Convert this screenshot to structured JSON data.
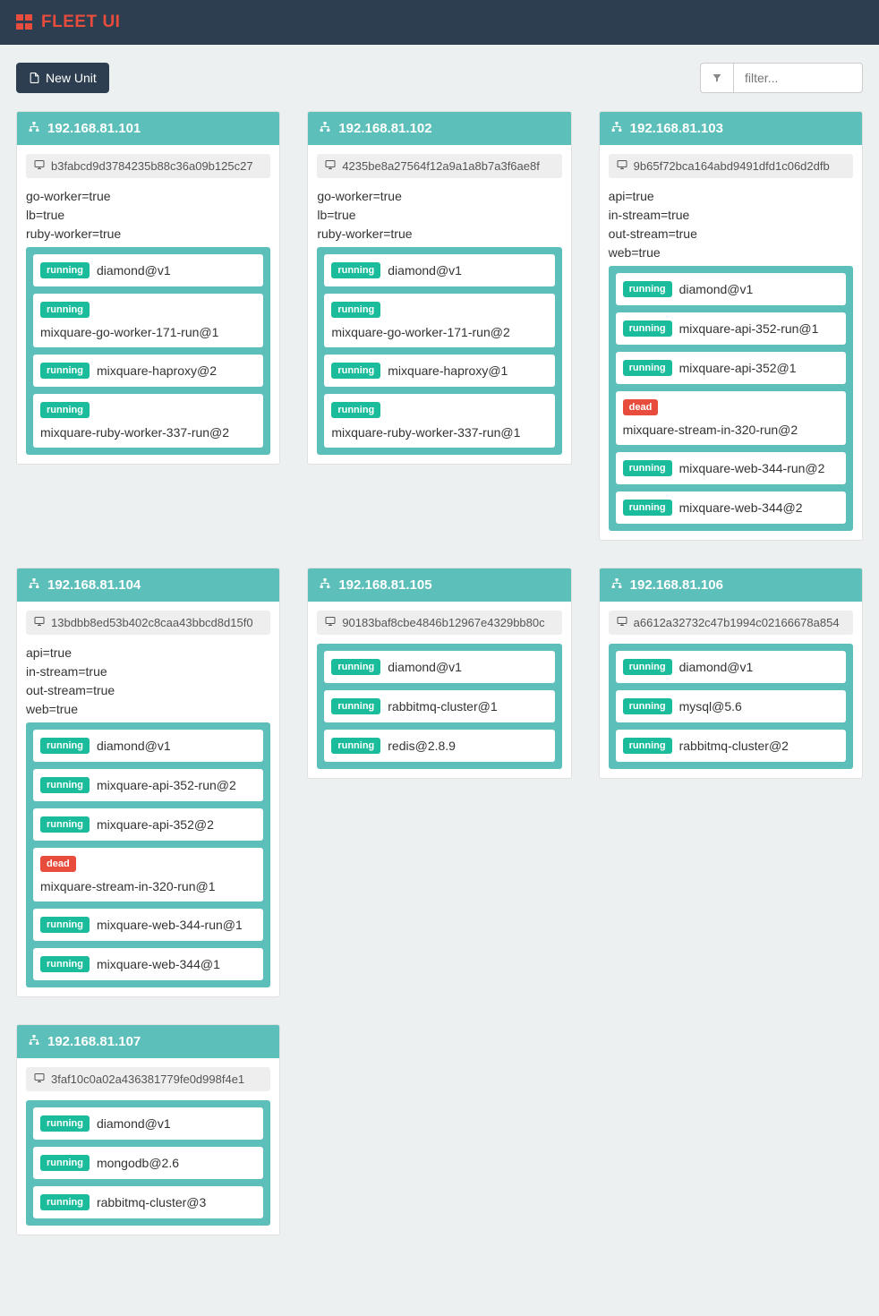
{
  "brand": "FLEET UI",
  "toolbar": {
    "new_unit_label": "New Unit",
    "filter_placeholder": "filter..."
  },
  "status_labels": {
    "running": "running",
    "dead": "dead"
  },
  "machines": [
    {
      "ip": "192.168.81.101",
      "hash": "b3fabcd9d3784235b88c36a09b125c27",
      "meta": [
        "go-worker=true",
        "lb=true",
        "ruby-worker=true"
      ],
      "units": [
        {
          "status": "running",
          "name": "diamond@v1"
        },
        {
          "status": "running",
          "name": "mixquare-go-worker-171-run@1"
        },
        {
          "status": "running",
          "name": "mixquare-haproxy@2"
        },
        {
          "status": "running",
          "name": "mixquare-ruby-worker-337-run@2"
        }
      ]
    },
    {
      "ip": "192.168.81.102",
      "hash": "4235be8a27564f12a9a1a8b7a3f6ae8f",
      "meta": [
        "go-worker=true",
        "lb=true",
        "ruby-worker=true"
      ],
      "units": [
        {
          "status": "running",
          "name": "diamond@v1"
        },
        {
          "status": "running",
          "name": "mixquare-go-worker-171-run@2"
        },
        {
          "status": "running",
          "name": "mixquare-haproxy@1"
        },
        {
          "status": "running",
          "name": "mixquare-ruby-worker-337-run@1"
        }
      ]
    },
    {
      "ip": "192.168.81.103",
      "hash": "9b65f72bca164abd9491dfd1c06d2dfb",
      "meta": [
        "api=true",
        "in-stream=true",
        "out-stream=true",
        "web=true"
      ],
      "units": [
        {
          "status": "running",
          "name": "diamond@v1"
        },
        {
          "status": "running",
          "name": "mixquare-api-352-run@1"
        },
        {
          "status": "running",
          "name": "mixquare-api-352@1"
        },
        {
          "status": "dead",
          "name": "mixquare-stream-in-320-run@2"
        },
        {
          "status": "running",
          "name": "mixquare-web-344-run@2"
        },
        {
          "status": "running",
          "name": "mixquare-web-344@2"
        }
      ]
    },
    {
      "ip": "192.168.81.104",
      "hash": "13bdbb8ed53b402c8caa43bbcd8d15f0",
      "meta": [
        "api=true",
        "in-stream=true",
        "out-stream=true",
        "web=true"
      ],
      "units": [
        {
          "status": "running",
          "name": "diamond@v1"
        },
        {
          "status": "running",
          "name": "mixquare-api-352-run@2"
        },
        {
          "status": "running",
          "name": "mixquare-api-352@2"
        },
        {
          "status": "dead",
          "name": "mixquare-stream-in-320-run@1"
        },
        {
          "status": "running",
          "name": "mixquare-web-344-run@1"
        },
        {
          "status": "running",
          "name": "mixquare-web-344@1"
        }
      ]
    },
    {
      "ip": "192.168.81.105",
      "hash": "90183baf8cbe4846b12967e4329bb80c",
      "meta": [],
      "units": [
        {
          "status": "running",
          "name": "diamond@v1"
        },
        {
          "status": "running",
          "name": "rabbitmq-cluster@1"
        },
        {
          "status": "running",
          "name": "redis@2.8.9"
        }
      ]
    },
    {
      "ip": "192.168.81.106",
      "hash": "a6612a32732c47b1994c02166678a854",
      "meta": [],
      "units": [
        {
          "status": "running",
          "name": "diamond@v1"
        },
        {
          "status": "running",
          "name": "mysql@5.6"
        },
        {
          "status": "running",
          "name": "rabbitmq-cluster@2"
        }
      ]
    },
    {
      "ip": "192.168.81.107",
      "hash": "3faf10c0a02a436381779fe0d998f4e1",
      "meta": [],
      "units": [
        {
          "status": "running",
          "name": "diamond@v1"
        },
        {
          "status": "running",
          "name": "mongodb@2.6"
        },
        {
          "status": "running",
          "name": "rabbitmq-cluster@3"
        }
      ]
    }
  ]
}
